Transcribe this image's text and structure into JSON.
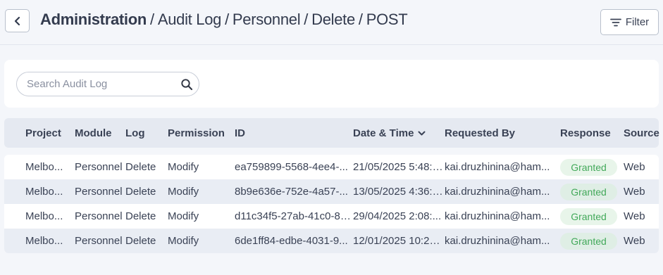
{
  "header": {
    "back_label": "Back",
    "breadcrumb": {
      "root": "Administration",
      "separator": "/",
      "items": [
        "Audit Log",
        "Personnel",
        "Delete",
        "POST"
      ]
    },
    "filter_label": "Filter"
  },
  "search": {
    "placeholder": "Search Audit Log",
    "value": ""
  },
  "table": {
    "columns": [
      "Project",
      "Module",
      "Log",
      "Permission",
      "ID",
      "Date & Time",
      "Requested By",
      "Response",
      "Source"
    ],
    "sorted_column": "Date & Time",
    "sort_direction": "descending",
    "rows": [
      {
        "project": "Melbo...",
        "module": "Personnel",
        "log": "Delete",
        "permission": "Modify",
        "id": "ea759899-5568-4ee4-...",
        "datetime": "21/05/2025 5:48:5...",
        "requested_by": "kai.druzhinina@ham...",
        "response": "Granted",
        "source": "Web"
      },
      {
        "project": "Melbo...",
        "module": "Personnel",
        "log": "Delete",
        "permission": "Modify",
        "id": "8b9e636e-752e-4a57-...",
        "datetime": "13/05/2025 4:36:1...",
        "requested_by": "kai.druzhinina@ham...",
        "response": "Granted",
        "source": "Web"
      },
      {
        "project": "Melbo...",
        "module": "Personnel",
        "log": "Delete",
        "permission": "Modify",
        "id": "d11c34f5-27ab-41c0-80...",
        "datetime": "29/04/2025 2:08:...",
        "requested_by": "kai.druzhinina@ham...",
        "response": "Granted",
        "source": "Web"
      },
      {
        "project": "Melbo...",
        "module": "Personnel",
        "log": "Delete",
        "permission": "Modify",
        "id": "6de1ff84-edbe-4031-9...",
        "datetime": "12/01/2025 10:26:...",
        "requested_by": "kai.druzhinina@ham...",
        "response": "Granted",
        "source": "Web"
      }
    ]
  },
  "colors": {
    "background": "#f4f6fa",
    "header_row": "#e5e9f1",
    "alt_row": "#e9edf4",
    "granted_text": "#43a95a",
    "granted_bg": "#e8f5ea"
  },
  "icons": {
    "back": "chevron-left-icon",
    "filter": "filter-lines-icon",
    "search": "magnifier-icon",
    "sort": "chevron-down-icon"
  }
}
